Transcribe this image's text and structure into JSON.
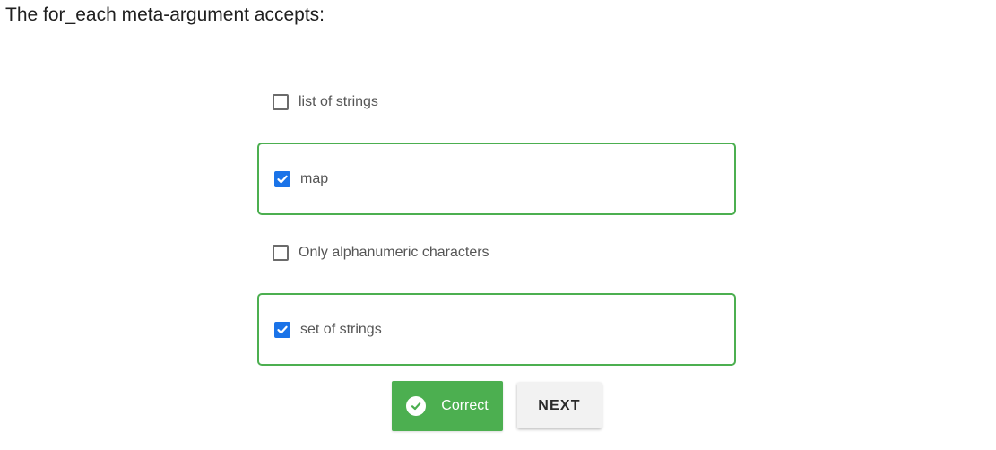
{
  "question": {
    "text": "The for_each meta-argument accepts:"
  },
  "options": [
    {
      "label": "list of strings",
      "checked": false
    },
    {
      "label": "map",
      "checked": true
    },
    {
      "label": "Only alphanumeric characters",
      "checked": false
    },
    {
      "label": "set of strings",
      "checked": true
    }
  ],
  "result_button": {
    "label": "Correct",
    "icon": "check-circle-icon",
    "color": "#4caf50"
  },
  "next_button": {
    "label": "NEXT"
  },
  "colors": {
    "selected_border": "#4caf50",
    "checkbox_checked": "#1a73e8"
  }
}
